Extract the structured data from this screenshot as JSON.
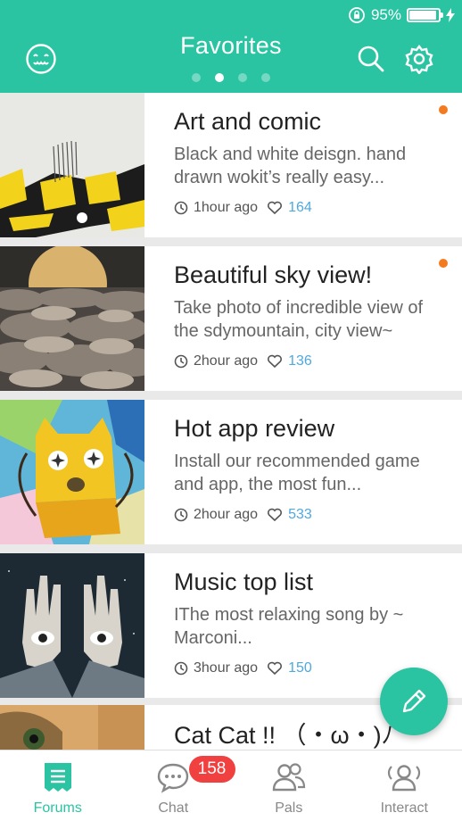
{
  "status_bar": {
    "battery_text": "95%",
    "battery_level": 0.95
  },
  "header": {
    "title": "Favorites",
    "pages": 4,
    "active_page": 1
  },
  "posts": [
    {
      "title": "Art and comic",
      "description": "Black and white deisgn. hand drawn wokit’s really easy...",
      "time": "1hour ago",
      "likes": "164",
      "unread": true,
      "image": "art-comic"
    },
    {
      "title": "Beautiful sky view!",
      "description": "Take photo of incredible view of the sdymountain, city view~",
      "time": "2hour ago",
      "likes": "136",
      "unread": true,
      "image": "sky-view"
    },
    {
      "title": "Hot app review",
      "description": "Install our recommended game and app, the most fun...",
      "time": "2hour ago",
      "likes": "533",
      "unread": false,
      "image": "cat-illustration"
    },
    {
      "title": "Music top list",
      "description": "IThe most relaxing song by ~ Marconi...",
      "time": "3hour ago",
      "likes": "150",
      "unread": false,
      "image": "hands-collage"
    },
    {
      "title": "Cat Cat !! （・ω・)ﾉ",
      "description": "",
      "time": "",
      "likes": "",
      "unread": false,
      "image": "cat-photo"
    }
  ],
  "tabs": [
    {
      "label": "Forums",
      "icon": "forum-icon",
      "active": true
    },
    {
      "label": "Chat",
      "icon": "chat-icon",
      "badge": "158"
    },
    {
      "label": "Pals",
      "icon": "pals-icon"
    },
    {
      "label": "Interact",
      "icon": "interact-icon"
    }
  ],
  "colors": {
    "accent": "#2bc4a3",
    "unread_dot": "#f47a20",
    "likes_text": "#4fa9dc",
    "badge": "#f0403f"
  }
}
